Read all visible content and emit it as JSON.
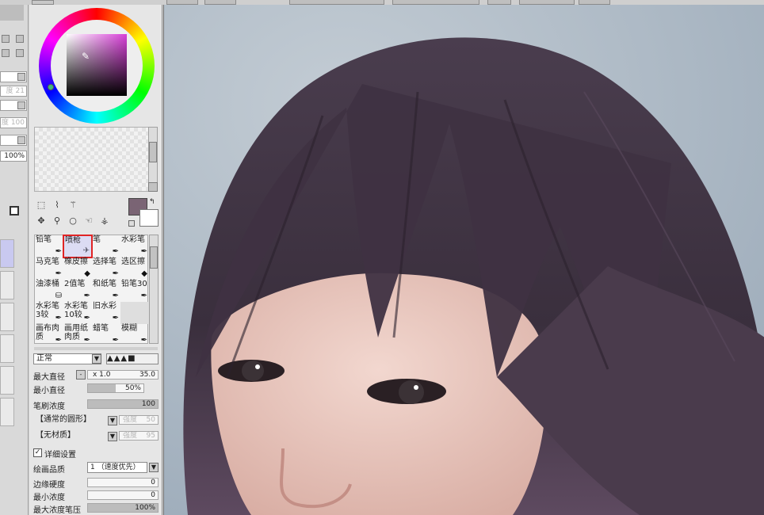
{
  "window": {
    "title": ""
  },
  "left_panel": {
    "fields": [
      "",
      "",
      "",
      "",
      "",
      ""
    ],
    "labels": [
      "度 21",
      "度 100",
      "100%"
    ]
  },
  "color": {
    "current_hex": "#7a6474",
    "wheel_hue": "magenta"
  },
  "brushes": [
    {
      "label": "铅笔",
      "row": 0
    },
    {
      "label": "喷枪",
      "row": 0,
      "selected": true
    },
    {
      "label": "笔",
      "row": 0
    },
    {
      "label": "水彩笔",
      "row": 0
    },
    {
      "label": "马克笔",
      "row": 1
    },
    {
      "label": "橡皮擦",
      "row": 1
    },
    {
      "label": "选择笔",
      "row": 1
    },
    {
      "label": "选区擦",
      "row": 1
    },
    {
      "label": "油漆桶",
      "row": 2
    },
    {
      "label": "2值笔",
      "row": 2
    },
    {
      "label": "和纸笔",
      "row": 2
    },
    {
      "label": "铅笔30",
      "row": 2
    },
    {
      "label": "水彩笔3较",
      "row": 3
    },
    {
      "label": "水彩笔10较",
      "row": 3
    },
    {
      "label": "旧水彩",
      "row": 3
    },
    {
      "label": "",
      "row": 3
    },
    {
      "label": "画布肉质",
      "row": 4
    },
    {
      "label": "画用纸肉质",
      "row": 4
    },
    {
      "label": "蜡笔",
      "row": 4
    },
    {
      "label": "模糊",
      "row": 4
    }
  ],
  "settings": {
    "blend_mode": "正常",
    "max_size_label": "最大直径",
    "max_size_mult": "x 1.0",
    "max_size_value": "35.0",
    "min_size_label": "最小直径",
    "min_size_value": "50%",
    "density_label": "笔刷浓度",
    "density_value": "100",
    "shape_select": "【通常的圆形】",
    "shape_strength_label": "强度",
    "shape_strength_value": "50",
    "texture_select": "【无材质】",
    "texture_strength_label": "强度",
    "texture_strength_value": "95",
    "detail_checkbox_label": "详细设置",
    "quality_label": "绘画品质",
    "quality_value": "1 （速度优先）",
    "edge_hardness_label": "边缘硬度",
    "edge_hardness_value": "0",
    "min_density_label": "最小浓度",
    "min_density_value": "0",
    "max_pressure_label": "最大浓度笔压",
    "max_pressure_value": "100%"
  },
  "canvas": {
    "background_hex": "#a7b4c1",
    "hair_hex": "#3a2f3d",
    "skin_hex": "#e9c9c1"
  }
}
